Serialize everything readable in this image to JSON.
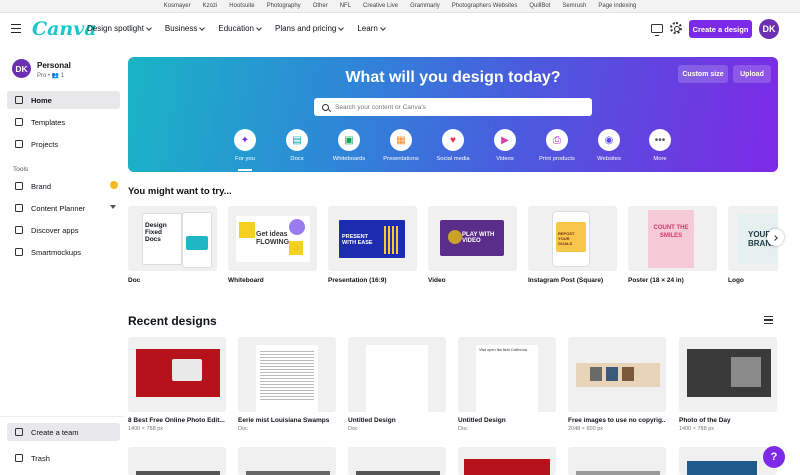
{
  "bookmarks": [
    "Kosmayer",
    "Kzozi",
    "Hootsuite",
    "Photography",
    "Other",
    "NFL",
    "Creative Live",
    "Grammarly",
    "Photographers Websites",
    "QuillBot",
    "Semrush",
    "Page indexing"
  ],
  "header": {
    "logo": "Canva",
    "nav": [
      "Design spotlight",
      "Business",
      "Education",
      "Plans and pricing",
      "Learn"
    ],
    "create_label": "Create a design",
    "avatar_initials": "DK"
  },
  "sidebar": {
    "profile_name": "Personal",
    "profile_sub": "Pro • 👥 1",
    "avatar_initials": "DK",
    "items": [
      "Home",
      "Templates",
      "Projects"
    ],
    "tools_label": "Tools",
    "tools": [
      "Brand",
      "Content Planner",
      "Discover apps",
      "Smartmockups"
    ],
    "bottom": [
      "Create a team",
      "Trash"
    ]
  },
  "hero": {
    "title": "What will you design today?",
    "custom_size": "Custom size",
    "upload": "Upload",
    "search_placeholder": "Search your content or Canva's",
    "categories": [
      {
        "label": "For you",
        "icon": "sparkle-icon",
        "color": "#7d2ae8",
        "glyph": "✦"
      },
      {
        "label": "Docs",
        "icon": "docs-icon",
        "color": "#13a3b5",
        "glyph": "▤"
      },
      {
        "label": "Whiteboards",
        "icon": "whiteboard-icon",
        "color": "#1e9e5a",
        "glyph": "▣"
      },
      {
        "label": "Presentations",
        "icon": "presentation-icon",
        "color": "#f28c28",
        "glyph": "▦"
      },
      {
        "label": "Social media",
        "icon": "heart-icon",
        "color": "#e8344f",
        "glyph": "♥"
      },
      {
        "label": "Videos",
        "icon": "video-icon",
        "color": "#d63fa8",
        "glyph": "▶"
      },
      {
        "label": "Print products",
        "icon": "print-icon",
        "color": "#b02bd1",
        "glyph": "⎙"
      },
      {
        "label": "Websites",
        "icon": "website-icon",
        "color": "#5b4ee8",
        "glyph": "◉"
      },
      {
        "label": "More",
        "icon": "more-icon",
        "color": "#555555",
        "glyph": "•••"
      }
    ]
  },
  "try_section": {
    "title": "You might want to try...",
    "items": [
      {
        "label": "Doc",
        "thumb_text": "Design Fixed Docs"
      },
      {
        "label": "Whiteboard",
        "thumb_text": "Get ideas FLOWING"
      },
      {
        "label": "Presentation (16:9)",
        "thumb_text": "PRESENT WITH EASE"
      },
      {
        "label": "Video",
        "thumb_text": "PLAY WITH VIDEO"
      },
      {
        "label": "Instagram Post (Square)",
        "thumb_text": "REPOST YOUR GOALS"
      },
      {
        "label": "Poster (18 × 24 in)",
        "thumb_text": "COUNT THE SMILES"
      },
      {
        "label": "Logo",
        "thumb_text": "YOUR BRAND"
      }
    ]
  },
  "recent": {
    "title": "Recent designs",
    "items": [
      {
        "title": "8 Best Free Online Photo Edit...",
        "meta": "1400 × 788 px"
      },
      {
        "title": "Eerie mist Louisiana Swamps",
        "meta": "Doc"
      },
      {
        "title": "Untitled Design",
        "meta": "Doc"
      },
      {
        "title": "Untitled Design",
        "meta": "Doc"
      },
      {
        "title": "Free images to use no copyrig...",
        "meta": "2048 × 600 px"
      },
      {
        "title": "Photo of the Day",
        "meta": "1400 × 788 px"
      }
    ],
    "doc4_heading": "Visit open flat field California"
  },
  "help_label": "?"
}
